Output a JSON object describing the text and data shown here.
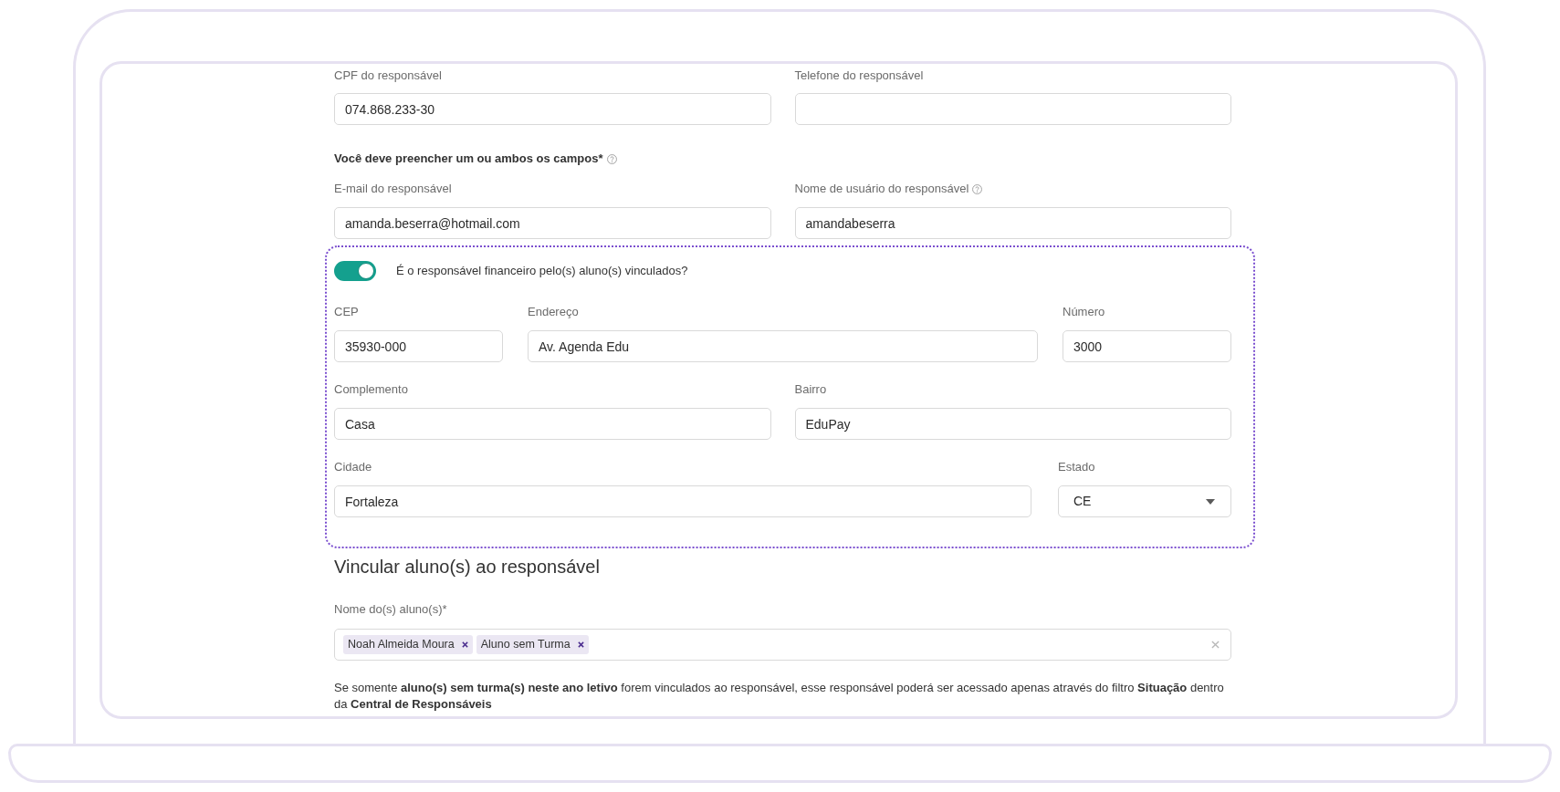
{
  "contact_row": [
    {
      "label": "CPF do responsável",
      "value": "074.868.233-30"
    },
    {
      "label": "Telefone do responsável"
    }
  ],
  "login_notice": {
    "text": "Você deve preencher um ou ambos os campos*",
    "help": true
  },
  "login_row": [
    {
      "label": "E-mail do responsável",
      "help": false,
      "value": "amanda.beserra@hotmail.com"
    },
    {
      "label": "Nome de usuário do responsável",
      "help": true,
      "value": "amandabeserra"
    }
  ],
  "financial": {
    "label": "É o responsável financeiro pelo(s) aluno(s) vinculados?",
    "on": true,
    "address_rows": [
      [
        {
          "kind": "text",
          "label": "CEP",
          "value": "35930-000"
        },
        {
          "kind": "text",
          "label": "Endereço",
          "value": "Av. Agenda Edu"
        },
        {
          "kind": "text",
          "label": "Número",
          "value": "3000"
        }
      ],
      [
        {
          "kind": "text",
          "label": "Complemento",
          "value": "Casa"
        },
        {
          "kind": "text",
          "label": "Bairro",
          "value": "EduPay"
        }
      ],
      [
        {
          "kind": "text",
          "label": "Cidade",
          "value": "Fortaleza"
        },
        {
          "kind": "select",
          "label": "Estado",
          "value": "CE"
        }
      ]
    ]
  },
  "students": {
    "title": "Vincular aluno(s) ao responsável",
    "label": "Nome do(s) aluno(s)*",
    "chips": [
      {
        "name": "Noah Almeida Moura"
      },
      {
        "name": "Aluno sem Turma"
      }
    ],
    "note": "Se somente **aluno(s) sem turma(s) neste ano letivo** forem vinculados ao responsável, esse responsável poderá ser acessado apenas através do filtro **Situação** dentro da **Central de Responsáveis**"
  }
}
